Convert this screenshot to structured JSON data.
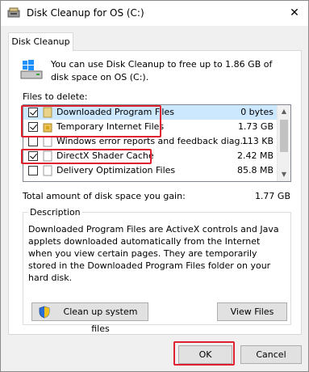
{
  "window": {
    "title": "Disk Cleanup for OS (C:)",
    "close_glyph": "✕",
    "icon": "disk-cleanup-icon"
  },
  "tab": {
    "label": "Disk Cleanup"
  },
  "intro": {
    "text": "You can use Disk Cleanup to free up to 1.86 GB of disk space on OS (C:).",
    "icon": "drive-icon"
  },
  "files": {
    "label": "Files to delete:",
    "items": [
      {
        "name": "Downloaded Program Files",
        "size": "0 bytes",
        "checked": true,
        "selected": true,
        "icon": "folder-icon",
        "highlighted": true
      },
      {
        "name": "Temporary Internet Files",
        "size": "1.73 GB",
        "checked": true,
        "selected": false,
        "icon": "lock-folder-icon",
        "highlighted": true
      },
      {
        "name": "Windows error reports and feedback diag...",
        "size": "113 KB",
        "checked": false,
        "selected": false,
        "icon": "document-icon",
        "highlighted": false
      },
      {
        "name": "DirectX Shader Cache",
        "size": "2.42 MB",
        "checked": true,
        "selected": false,
        "icon": "document-icon",
        "highlighted": true
      },
      {
        "name": "Delivery Optimization Files",
        "size": "85.8 MB",
        "checked": false,
        "selected": false,
        "icon": "document-icon",
        "highlighted": false
      }
    ]
  },
  "total": {
    "label": "Total amount of disk space you gain:",
    "value": "1.77 GB"
  },
  "description": {
    "title": "Description",
    "text": "Downloaded Program Files are ActiveX controls and Java applets downloaded automatically from the Internet when you view certain pages. They are temporarily stored in the Downloaded Program Files folder on your hard disk."
  },
  "buttons": {
    "cleanup_system": "Clean up system files",
    "view_files": "View Files",
    "ok": "OK",
    "cancel": "Cancel"
  },
  "colors": {
    "highlight": "#e0202f",
    "selection": "#cce8ff"
  }
}
